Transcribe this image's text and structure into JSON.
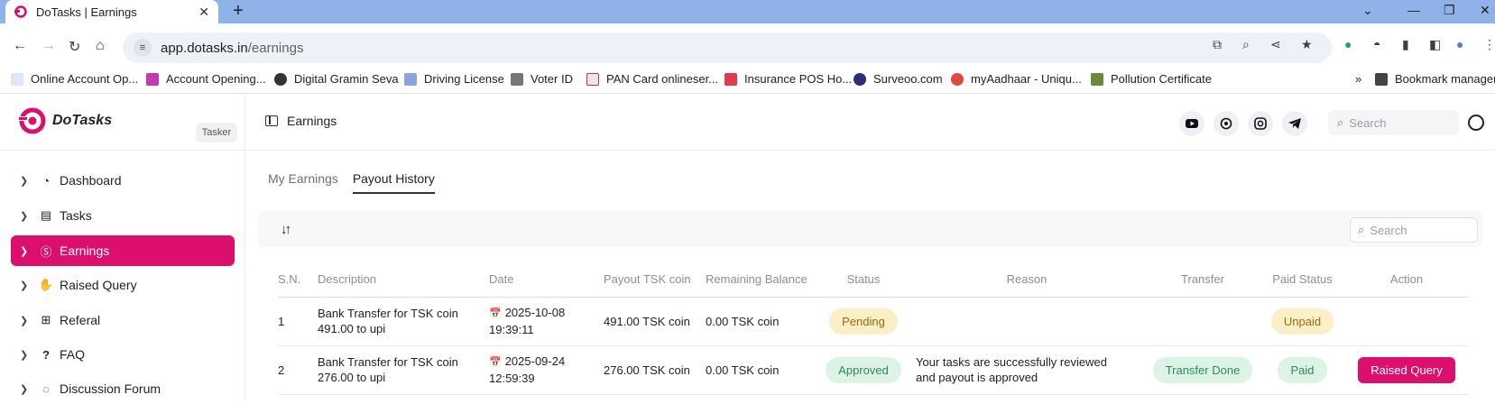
{
  "browser": {
    "tab_title": "DoTasks | Earnings",
    "url_host": "app.dotasks.in",
    "url_path": "/earnings",
    "bookmarks": [
      "Online Account Op...",
      "Account Opening...",
      "Digital Gramin Seva",
      "Driving License",
      "Voter ID",
      "PAN Card onlineser...",
      "Insurance POS Ho...",
      "Surveoo.com",
      "myAadhaar - Uniqu...",
      "Pollution Certificate"
    ],
    "bookmark_manager": "Bookmark manager",
    "more_bookmarks": "»"
  },
  "app": {
    "brand": "DoTasks",
    "role_badge": "Tasker",
    "page_title": "Earnings",
    "search_placeholder": "Search",
    "nav": [
      {
        "label": "Dashboard",
        "icon": "dashboard-icon"
      },
      {
        "label": "Tasks",
        "icon": "tasks-icon"
      },
      {
        "label": "Earnings",
        "icon": "earnings-icon",
        "active": true
      },
      {
        "label": "Raised Query",
        "icon": "hand-icon"
      },
      {
        "label": "Referal",
        "icon": "referral-icon"
      },
      {
        "label": "FAQ",
        "icon": "question-icon"
      },
      {
        "label": "Discussion Forum",
        "icon": "forum-icon"
      }
    ],
    "social_icons": [
      "youtube-icon",
      "whatsapp-icon",
      "instagram-icon",
      "telegram-icon"
    ],
    "tabs": [
      "My Earnings",
      "Payout History"
    ],
    "active_tab": "Payout History",
    "table_search_placeholder": "Search",
    "columns": [
      "S.N.",
      "Description",
      "Date",
      "Payout TSK coin",
      "Remaining Balance",
      "Status",
      "Reason",
      "Transfer",
      "Paid Status",
      "Action"
    ],
    "rows": [
      {
        "sn": "1",
        "description": "Bank Transfer for TSK coin 491.00 to upi",
        "date": "2025-10-08",
        "time": "19:39:11",
        "payout": "491.00 TSK coin",
        "remaining": "0.00 TSK coin",
        "status": "Pending",
        "reason": "",
        "transfer": "",
        "paid_status": "Unpaid",
        "action": ""
      },
      {
        "sn": "2",
        "description": "Bank Transfer for TSK coin 276.00 to upi",
        "date": "2025-09-24",
        "time": "12:59:39",
        "payout": "276.00 TSK coin",
        "remaining": "0.00 TSK coin",
        "status": "Approved",
        "reason": "Your tasks are successfully reviewed and payout is approved",
        "transfer": "Transfer Done",
        "paid_status": "Paid",
        "action": "Raised Query"
      }
    ]
  }
}
